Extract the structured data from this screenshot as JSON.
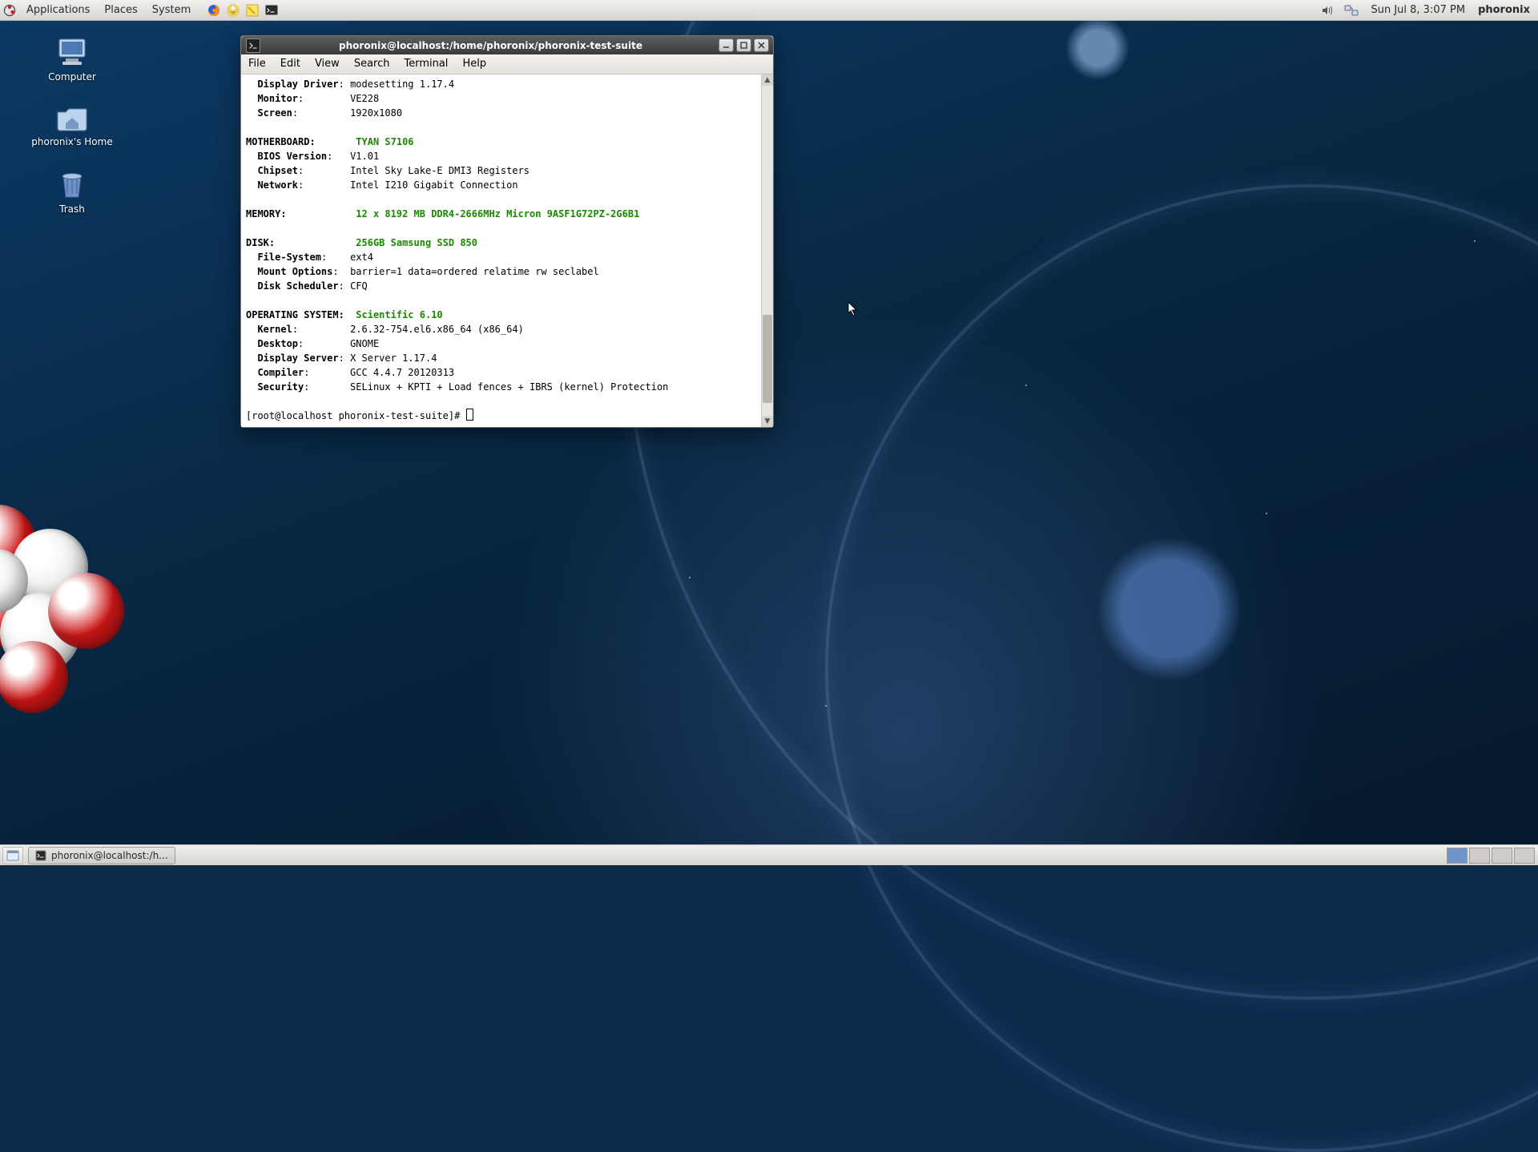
{
  "panel": {
    "menus": [
      "Applications",
      "Places",
      "System"
    ],
    "clock": "Sun Jul  8,  3:07 PM",
    "user": "phoronix"
  },
  "desktop_icons": {
    "computer": "Computer",
    "home": "phoronix's Home",
    "trash": "Trash"
  },
  "taskbar": {
    "button": "phoronix@localhost:/h..."
  },
  "terminal_window": {
    "title": "phoronix@localhost:/home/phoronix/phoronix-test-suite",
    "menubar": [
      "File",
      "Edit",
      "View",
      "Search",
      "Terminal",
      "Help"
    ],
    "prompt": "[root@localhost phoronix-test-suite]# ",
    "lines": {
      "display_driver_k": "Display Driver",
      "display_driver_v": "modesetting 1.17.4",
      "monitor_k": "Monitor",
      "monitor_v": "VE228",
      "screen_k": "Screen",
      "screen_v": "1920x1080",
      "mobo_header": "MOTHERBOARD:",
      "mobo_v": "TYAN S7106",
      "bios_k": "BIOS Version",
      "bios_v": "V1.01",
      "chipset_k": "Chipset",
      "chipset_v": "Intel Sky Lake-E DMI3 Registers",
      "network_k": "Network",
      "network_v": "Intel I210 Gigabit Connection",
      "memory_header": "MEMORY:",
      "memory_v": "12 x 8192 MB DDR4-2666MHz Micron 9ASF1G72PZ-2G6B1",
      "disk_header": "DISK:",
      "disk_v": "256GB Samsung SSD 850",
      "fs_k": "File-System",
      "fs_v": "ext4",
      "mount_k": "Mount Options",
      "mount_v": "barrier=1 data=ordered relatime rw seclabel",
      "scheduler_k": "Disk Scheduler",
      "scheduler_v": "CFQ",
      "os_header": "OPERATING SYSTEM:",
      "os_v": "Scientific 6.10",
      "kernel_k": "Kernel",
      "kernel_v": "2.6.32-754.el6.x86_64 (x86_64)",
      "desktop_k": "Desktop",
      "desktop_v": "GNOME",
      "dserver_k": "Display Server",
      "dserver_v": "X Server 1.17.4",
      "compiler_k": "Compiler",
      "compiler_v": "GCC 4.4.7 20120313",
      "security_k": "Security",
      "security_v": "SELinux + KPTI + Load fences + IBRS (kernel) Protection"
    }
  }
}
